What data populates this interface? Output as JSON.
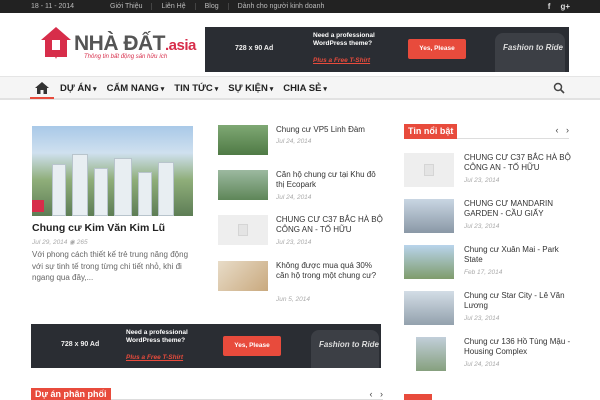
{
  "topbar": {
    "date": "18 - 11 - 2014",
    "menu": [
      "Giới Thiệu",
      "Liên Hệ",
      "Blog",
      "Dành cho người kinh doanh"
    ],
    "social": [
      "f",
      "g+"
    ]
  },
  "logo": {
    "name": "NHÀ ĐẤT",
    "suffix": ".asia",
    "tagline": "Thông tin bất động sản hữu ích"
  },
  "ad_header": {
    "size": "728 x 90 Ad",
    "need": "Need a professional WordPress theme?",
    "plus": "Plus a Free T-Shirt",
    "cta": "Yes, Please",
    "shirt": "Fashion to Ride"
  },
  "ad_mid": {
    "size": "728 x 90 Ad",
    "need": "Need a professional WordPress theme?",
    "plus": "Plus a Free T-Shirt",
    "cta": "Yes, Please",
    "shirt": "Fashion to Ride"
  },
  "nav": {
    "items": [
      "DỰ ÁN",
      "CẨM NANG",
      "TIN TỨC",
      "SỰ KIỆN",
      "CHIA SẺ"
    ]
  },
  "featured": {
    "title": "Chung cư Kim Văn Kim Lũ",
    "date": "Jul 29, 2014",
    "views": "265",
    "excerpt": "Với phong cách thiết kế trẻ trung năng động với sự tinh tế trong từng chi tiết nhỏ, khi đi ngang qua đây,..."
  },
  "mid_list": [
    {
      "title": "Chung cư VP5 Linh Đàm",
      "date": "Jul 24, 2014"
    },
    {
      "title": "Căn hộ chung cư tại Khu đô thị Ecopark",
      "date": "Jul 24, 2014"
    },
    {
      "title": "CHUNG CƯ C37 BẮC HÀ BỘ CÔNG AN - TỐ HỮU",
      "date": "Jul 23, 2014"
    },
    {
      "title": "Không được mua quá 30% căn hộ trong một chung cư?",
      "date": "Jun 5, 2014"
    }
  ],
  "sidebar": {
    "heading": "Tin nổi bật",
    "items": [
      {
        "title": "CHUNG CƯ C37 BẮC HÀ BỘ CÔNG AN - TỐ HỮU",
        "date": "Jul 23, 2014"
      },
      {
        "title": "CHUNG CƯ MANDARIN GARDEN - CẦU GIẤY",
        "date": "Jul 23, 2014"
      },
      {
        "title": "Chung cư Xuân Mai - Park State",
        "date": "Feb 17, 2014"
      },
      {
        "title": "Chung cư Star City - Lê Văn Lương",
        "date": "Jul 23, 2014"
      },
      {
        "title": "Chung cư 136 Hồ Tùng Mậu - Housing Complex",
        "date": "Jul 24, 2014"
      }
    ]
  },
  "bottom": {
    "heading": "Dự án phân phối"
  },
  "colors": {
    "accent": "#e84b3c",
    "brand": "#d72d4a",
    "topbar": "#222222"
  }
}
